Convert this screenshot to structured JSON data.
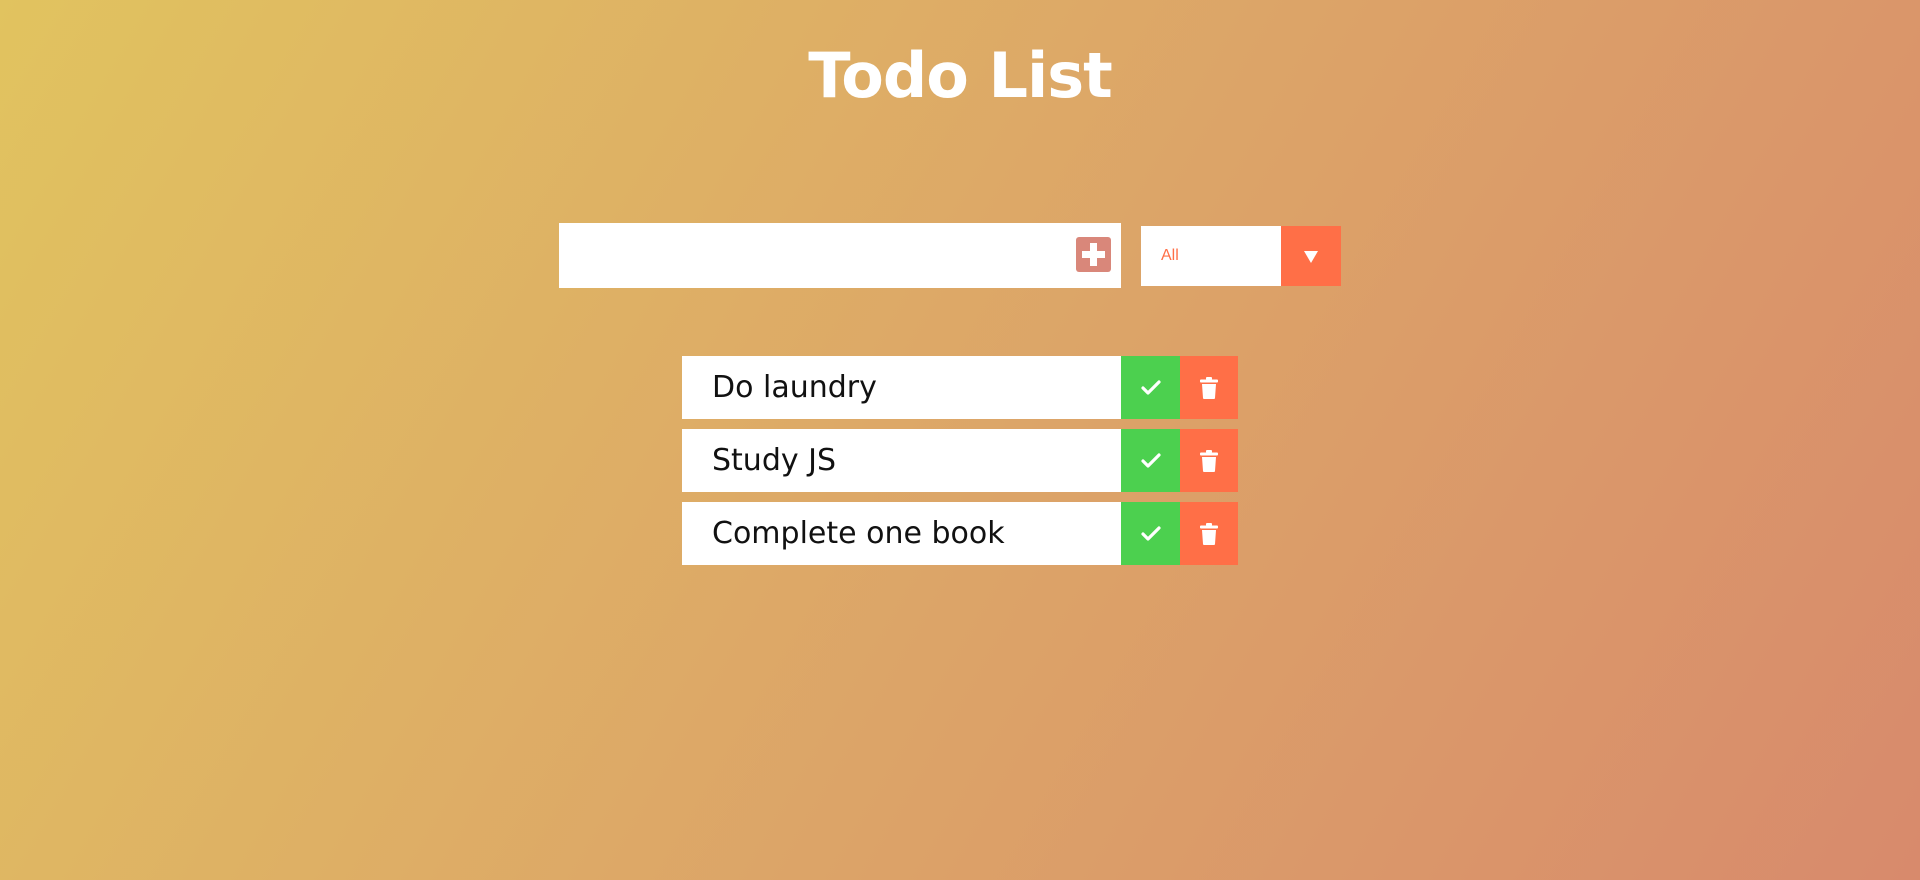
{
  "app": {
    "title": "Todo List"
  },
  "form": {
    "input_value": "",
    "input_placeholder": "",
    "add_icon": "plus-square-icon"
  },
  "filter": {
    "selected": "All",
    "arrow_icon": "caret-down-icon"
  },
  "todos": [
    {
      "text": "Do laundry",
      "complete_icon": "check-icon",
      "delete_icon": "trash-icon"
    },
    {
      "text": "Study JS",
      "complete_icon": "check-icon",
      "delete_icon": "trash-icon"
    },
    {
      "text": "Complete one book",
      "complete_icon": "check-icon",
      "delete_icon": "trash-icon"
    }
  ],
  "colors": {
    "accent": "#ff6f47",
    "complete": "#4cd04f",
    "add_button": "#d9877a",
    "gradient_start": "#e1c35f",
    "gradient_end": "#d88a6c"
  }
}
